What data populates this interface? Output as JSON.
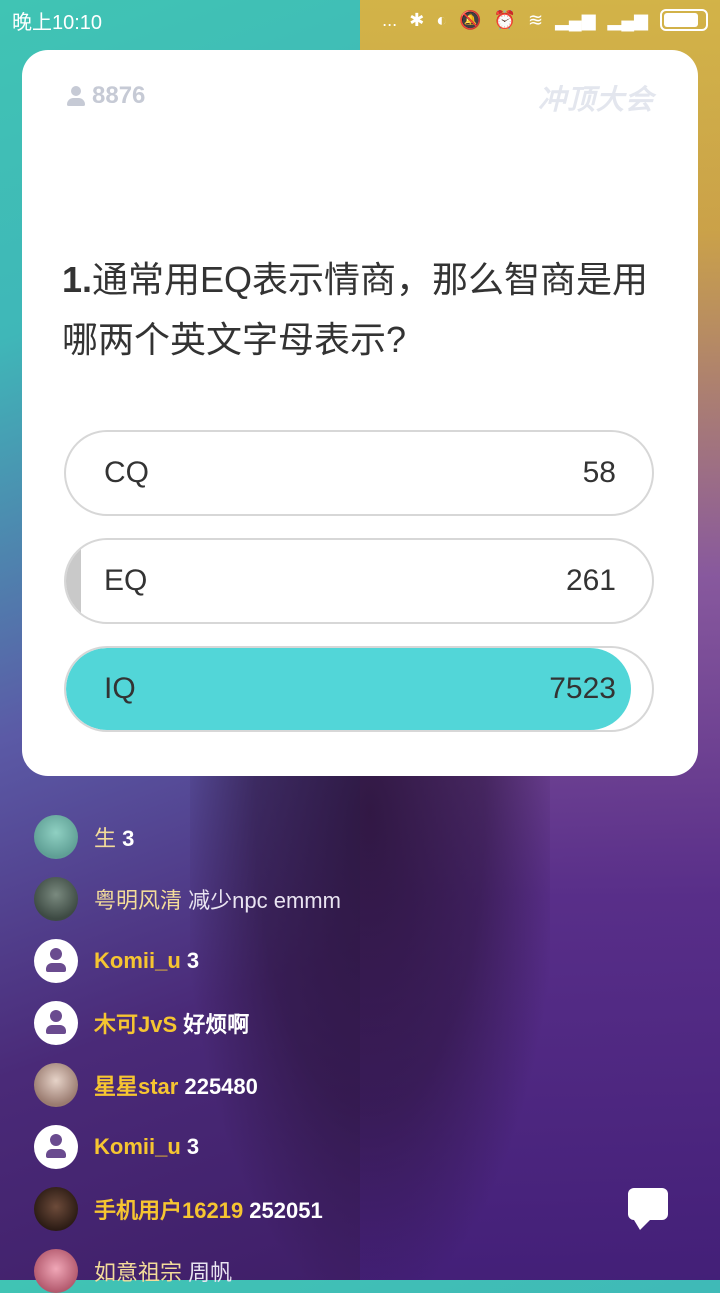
{
  "status_bar": {
    "time": "晚上10:10",
    "dots": "..."
  },
  "card": {
    "viewer_count": "8876",
    "logo_text": "冲顶大会",
    "question": {
      "number": "1.",
      "text": "通常用EQ表示情商，那么智商是用哪两个英文字母表示?"
    },
    "options": [
      {
        "label": "CQ",
        "count": "58",
        "fill_fraction": 0.0,
        "fill_color": "#ffffff"
      },
      {
        "label": "EQ",
        "count": "261",
        "fill_fraction": 0.025,
        "fill_color": "#c9c9c9"
      },
      {
        "label": "IQ",
        "count": "7523",
        "fill_fraction": 0.965,
        "fill_color": "#52d6d8"
      }
    ]
  },
  "comments": [
    {
      "nick": "生",
      "msg": "3",
      "avatar": "photo2"
    },
    {
      "nick": "粤明风清",
      "msg": "减少npc      emmm",
      "avatar": "photo"
    },
    {
      "nick": "Komii_u",
      "msg": "3",
      "avatar": "default"
    },
    {
      "nick": "木可JvS",
      "msg": "好烦啊",
      "avatar": "default"
    },
    {
      "nick": "星星star",
      "msg": "225480",
      "avatar": "photo3"
    },
    {
      "nick": "Komii_u",
      "msg": "3",
      "avatar": "default"
    },
    {
      "nick": "手机用户16219",
      "msg": "252051",
      "avatar": "photo4"
    },
    {
      "nick": "如意祖宗",
      "msg": "周帆",
      "avatar": "photo5"
    }
  ],
  "colors": {
    "accent": "#52d6d8",
    "nick": "#f6c531"
  }
}
